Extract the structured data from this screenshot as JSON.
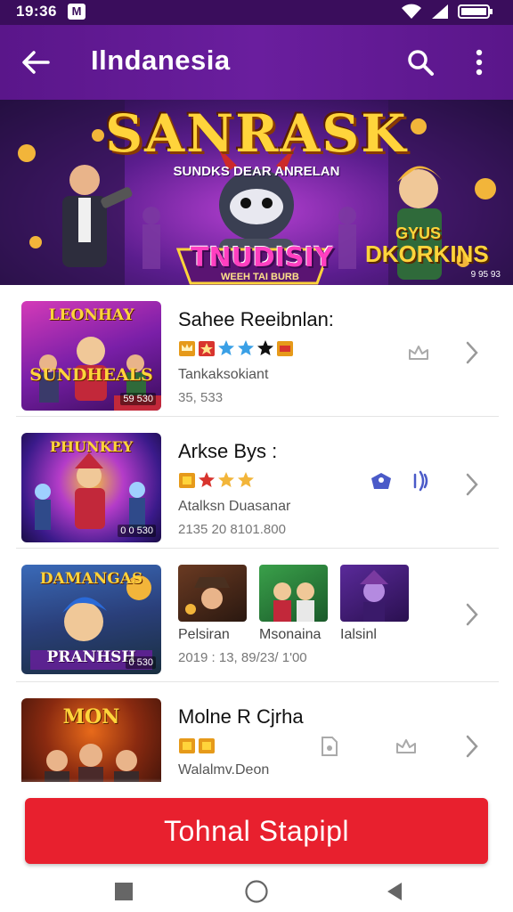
{
  "status_bar": {
    "time": "19:36",
    "app_icon_letter": "M"
  },
  "app_bar": {
    "title": "Ilndanesia"
  },
  "banner": {
    "title": "SANRASK",
    "subtitle": "SUNDKS DEAR ANRELAN",
    "logo_text": "TNUDISIY",
    "logo_sub": "WEEH TAI BURB",
    "right_a": "GYUS",
    "right_b": "DKORKINS",
    "corner": "9 95 93"
  },
  "list": {
    "rows": [
      {
        "title": "Sahee Reeibnlan:",
        "subtitle": "Tankaksokiant",
        "meta": "35, 533",
        "thumb_title": "LEONHAY",
        "thumb_title_2": "SUNDHEALS",
        "thumb_tag": "59 530"
      },
      {
        "title": "Arkse Bys :",
        "subtitle": "Atalksn Duasanar",
        "meta": "2135 20 8101.800",
        "thumb_title": "PHUNKEY",
        "thumb_tag": "0 0 530"
      },
      {
        "thumb_title": "DAMANGAS",
        "thumb_title_2": "PRANHSH",
        "thumb_tag": "0 530",
        "mini_labels": [
          "Pelsiran",
          "Msonaina",
          "Ialsinl"
        ],
        "meta": "2019 : 13, 89/23/ 1'00"
      },
      {
        "title": "Molne R Cjrha",
        "subtitle": "Walalmv.Deon",
        "thumb_title": "MON"
      }
    ]
  },
  "cta": {
    "label": "Tohnal Stapipl"
  },
  "colors": {
    "app_bar": "#5a168a",
    "status_bar": "#3a0d5c",
    "cta": "#e8202e",
    "gold": "#ffd43b"
  }
}
